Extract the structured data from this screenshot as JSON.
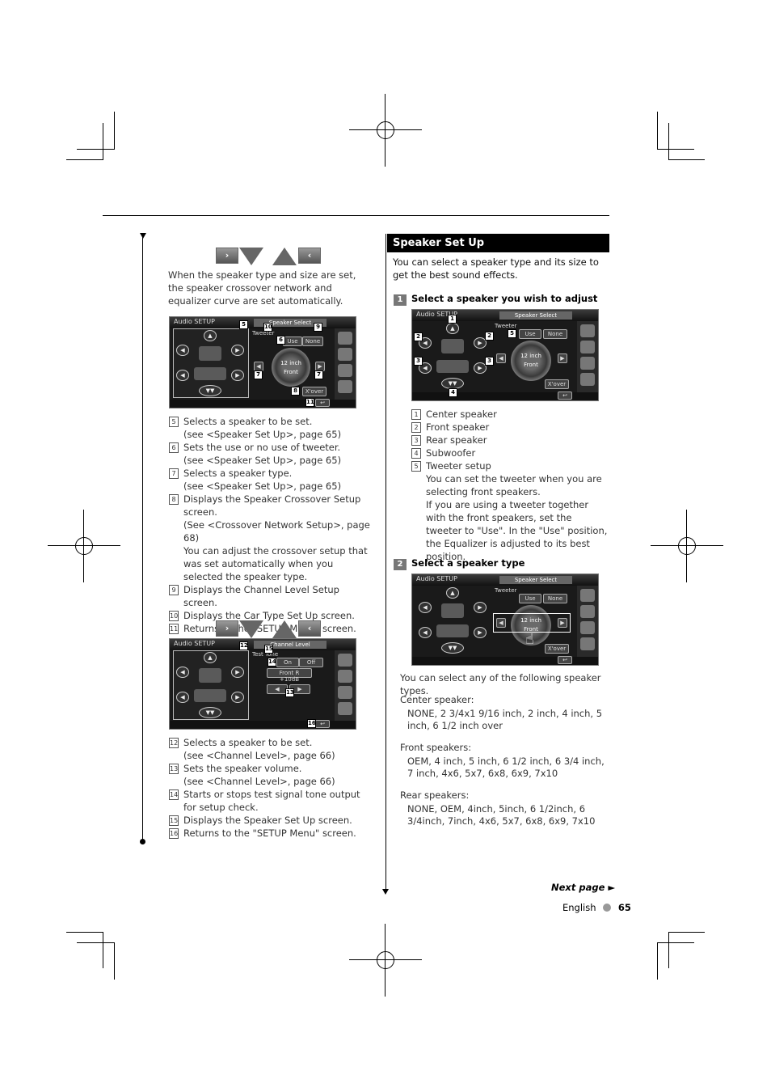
{
  "left_column": {
    "intro": "When the speaker type and size are set, the speaker crossover network and equalizer curve are set automatically.",
    "nav_icons": [
      "next-arrow-icon",
      "down-arrow-icon",
      "up-arrow-icon",
      "prev-arrow-icon"
    ],
    "screen1": {
      "title": "Audio SETUP",
      "selector_label": "Speaker Select",
      "tweeter_label": "Tweeter",
      "use_label": "Use",
      "none_label": "None",
      "dial_size": "12 inch",
      "dial_position": "Front",
      "xover_label": "X'over",
      "callouts": [
        "5",
        "10",
        "9",
        "6",
        "7",
        "7",
        "8",
        "11"
      ]
    },
    "list1": [
      {
        "num": "5",
        "lines": [
          "Selects a speaker to be set.",
          "(see <Speaker Set Up>, page 65)"
        ]
      },
      {
        "num": "6",
        "lines": [
          "Sets the use or no use of tweeter.",
          "(see <Speaker Set Up>, page 65)"
        ]
      },
      {
        "num": "7",
        "lines": [
          "Selects a speaker type.",
          "(see <Speaker Set Up>, page 65)"
        ]
      },
      {
        "num": "8",
        "lines": [
          "Displays the Speaker Crossover Setup screen.",
          "(See <Crossover Network Setup>, page 68)",
          "You can adjust the crossover setup that was set automatically when you selected the speaker type."
        ]
      },
      {
        "num": "9",
        "lines": [
          "Displays the Channel Level Setup screen."
        ]
      },
      {
        "num": "10",
        "lines": [
          "Displays the Car Type Set Up screen."
        ]
      },
      {
        "num": "11",
        "lines": [
          "Returns to the \"SETUP Menu\" screen."
        ]
      }
    ],
    "screen2": {
      "title": "Audio SETUP",
      "selector_label": "Channel Level",
      "test_tone_label": "Test Tone",
      "on_label": "On",
      "off_label": "Off",
      "channel": "Front R",
      "level": "+10dB",
      "callouts": [
        "12",
        "15",
        "14",
        "13",
        "16"
      ]
    },
    "list2": [
      {
        "num": "12",
        "lines": [
          "Selects a speaker to be set.",
          "(see <Channel Level>, page 66)"
        ]
      },
      {
        "num": "13",
        "lines": [
          "Sets the speaker volume.",
          "(see <Channel Level>, page 66)"
        ]
      },
      {
        "num": "14",
        "lines": [
          "Starts or stops test signal tone output for setup check."
        ]
      },
      {
        "num": "15",
        "lines": [
          "Displays the Speaker Set Up screen."
        ]
      },
      {
        "num": "16",
        "lines": [
          "Returns to the \"SETUP Menu\" screen."
        ]
      }
    ]
  },
  "right_column": {
    "section_title": "Speaker Set Up",
    "intro": "You can select a speaker type and its size to get the best sound effects.",
    "step1": {
      "num": "1",
      "label": "Select a speaker you wish to adjust"
    },
    "screen3": {
      "title": "Audio SETUP",
      "selector_label": "Speaker Select",
      "tweeter_label": "Tweeter",
      "use_label": "Use",
      "none_label": "None",
      "dial_size": "12 inch",
      "dial_position": "Front",
      "xover_label": "X'over"
    },
    "list3": [
      {
        "num": "1",
        "lines": [
          "Center speaker"
        ]
      },
      {
        "num": "2",
        "lines": [
          "Front speaker"
        ]
      },
      {
        "num": "3",
        "lines": [
          "Rear speaker"
        ]
      },
      {
        "num": "4",
        "lines": [
          "Subwoofer"
        ]
      },
      {
        "num": "5",
        "lines": [
          "Tweeter setup",
          "You can set the tweeter when you are selecting front speakers.",
          "If you are using a tweeter together with the front speakers, set the tweeter to \"Use\". In the \"Use\" position, the Equalizer is adjusted to its best position."
        ]
      }
    ],
    "step2": {
      "num": "2",
      "label": "Select a speaker type"
    },
    "screen4": {
      "title": "Audio SETUP",
      "selector_label": "Speaker Select",
      "tweeter_label": "Tweeter",
      "use_label": "Use",
      "none_label": "None",
      "dial_size": "12 inch",
      "dial_position": "Front",
      "xover_label": "X'over"
    },
    "types_intro": "You can select any of the following speaker types.",
    "speaker_types": [
      {
        "heading": "Center speaker:",
        "values": "NONE, 2 3/4x1 9/16 inch, 2 inch, 4 inch, 5 inch, 6 1/2 inch over"
      },
      {
        "heading": "Front speakers:",
        "values": "OEM, 4 inch, 5 inch, 6 1/2 inch, 6 3/4 inch, 7 inch, 4x6, 5x7, 6x8, 6x9, 7x10"
      },
      {
        "heading": "Rear speakers:",
        "values": "NONE, OEM, 4inch, 5inch, 6 1/2inch, 6 3/4inch, 7inch, 4x6, 5x7, 6x8, 6x9, 7x10"
      }
    ]
  },
  "footer": {
    "next_page": "Next page ►",
    "language": "English",
    "page_number": "65"
  }
}
